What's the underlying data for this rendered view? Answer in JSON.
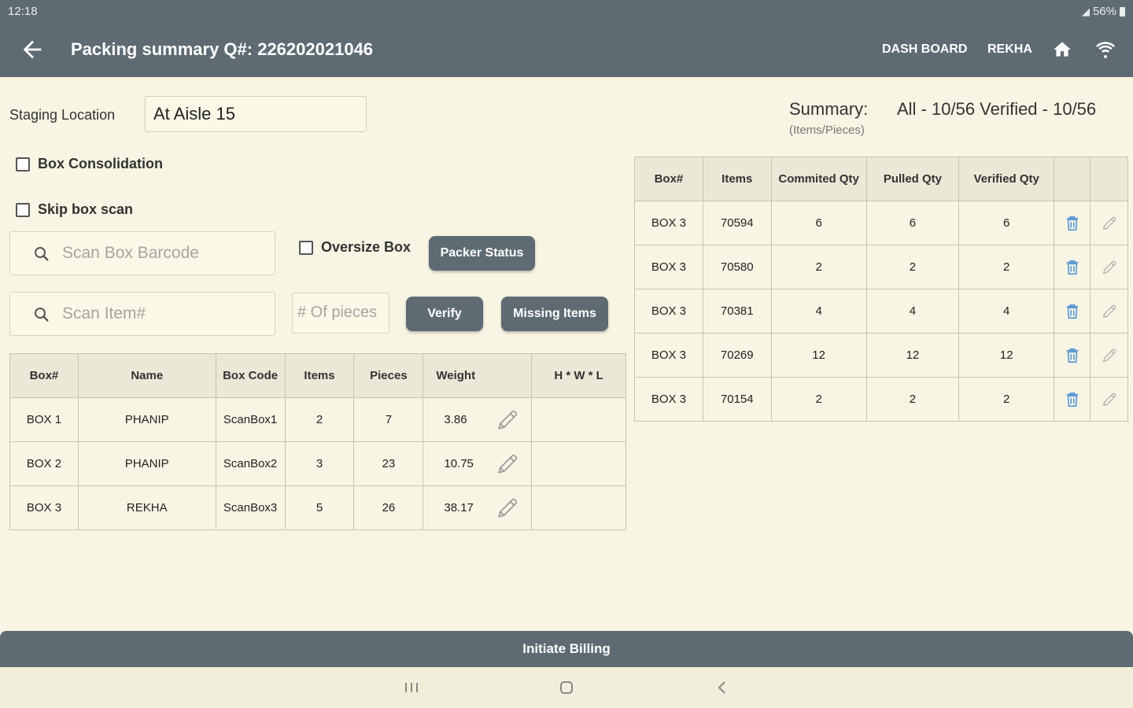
{
  "status": {
    "time": "12:18",
    "battery": "56%"
  },
  "header": {
    "title": "Packing summary Q#: 226202021046",
    "nav_dashboard": "DASH BOARD",
    "nav_user": "REKHA"
  },
  "staging": {
    "label": "Staging Location",
    "value": "At Aisle 15"
  },
  "options": {
    "box_consolidation": "Box Consolidation",
    "skip_box_scan": "Skip box scan",
    "oversize_box": "Oversize Box"
  },
  "search": {
    "box_placeholder": "Scan Box Barcode",
    "item_placeholder": "Scan Item#",
    "pieces_placeholder": "# Of pieces"
  },
  "buttons": {
    "packer_status": "Packer Status",
    "verify": "Verify",
    "missing_items": "Missing Items",
    "initiate_billing": "Initiate Billing"
  },
  "summary": {
    "title": "Summary:",
    "subtitle": "(Items/Pieces)",
    "values": "All - 10/56  Verified - 10/56"
  },
  "boxes_table": {
    "headers": [
      "Box#",
      "Name",
      "Box Code",
      "Items",
      "Pieces",
      "Weight",
      "H * W * L"
    ],
    "rows": [
      {
        "box": "BOX 1",
        "name": "PHANIP",
        "code": "ScanBox1",
        "items": "2",
        "pieces": "7",
        "weight": "3.86",
        "dims": ""
      },
      {
        "box": "BOX 2",
        "name": "PHANIP",
        "code": "ScanBox2",
        "items": "3",
        "pieces": "23",
        "weight": "10.75",
        "dims": ""
      },
      {
        "box": "BOX 3",
        "name": "REKHA",
        "code": "ScanBox3",
        "items": "5",
        "pieces": "26",
        "weight": "38.17",
        "dims": ""
      }
    ]
  },
  "items_table": {
    "headers": [
      "Box#",
      "Items",
      "Commited Qty",
      "Pulled Qty",
      "Verified Qty",
      "",
      ""
    ],
    "rows": [
      {
        "box": "BOX 3",
        "item": "70594",
        "committed": "6",
        "pulled": "6",
        "verified": "6"
      },
      {
        "box": "BOX 3",
        "item": "70580",
        "committed": "2",
        "pulled": "2",
        "verified": "2"
      },
      {
        "box": "BOX 3",
        "item": "70381",
        "committed": "4",
        "pulled": "4",
        "verified": "4"
      },
      {
        "box": "BOX 3",
        "item": "70269",
        "committed": "12",
        "pulled": "12",
        "verified": "12"
      },
      {
        "box": "BOX 3",
        "item": "70154",
        "committed": "2",
        "pulled": "2",
        "verified": "2"
      }
    ]
  },
  "icons": [
    "back-arrow-icon",
    "home-icon",
    "wifi-icon",
    "search-icon",
    "pencil-icon",
    "trash-icon"
  ],
  "colors": {
    "bar": "#5f6b73",
    "background": "#f8f5e4",
    "accent_icon": "#4a8fd0"
  }
}
